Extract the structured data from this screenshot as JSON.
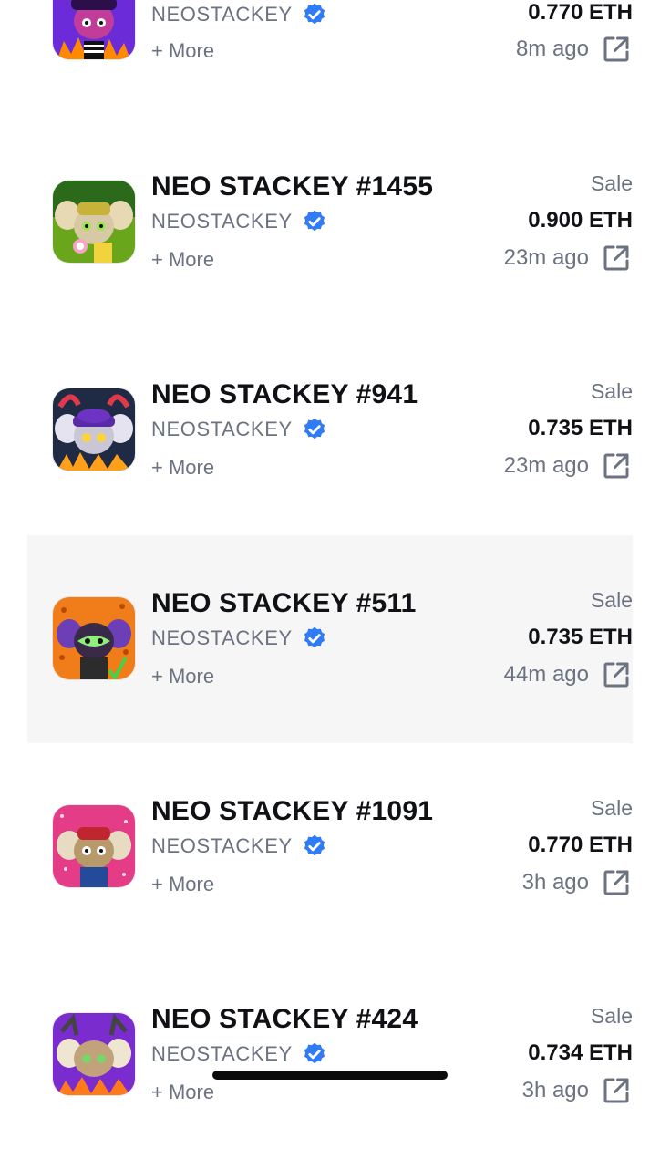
{
  "colors": {
    "verified_blue": "#2f7cf6",
    "text_primary": "#0f1115",
    "text_secondary": "#6b7280",
    "highlight_bg": "#f6f6f7"
  },
  "icons": {
    "verified": "verified-badge-icon",
    "external": "external-link-icon"
  },
  "items": [
    {
      "title": "",
      "collection": "NEOSTACKEY",
      "more": "+ More",
      "kind": "",
      "price": "0.770 ETH",
      "time": "8m ago",
      "thumb_bg": "#6c2bd9"
    },
    {
      "title": "NEO STACKEY #1455",
      "collection": "NEOSTACKEY",
      "more": "+ More",
      "kind": "Sale",
      "price": "0.900 ETH",
      "time": "23m ago",
      "thumb_bg": "#6aa61c"
    },
    {
      "title": "NEO STACKEY #941",
      "collection": "NEOSTACKEY",
      "more": "+ More",
      "kind": "Sale",
      "price": "0.735 ETH",
      "time": "23m ago",
      "thumb_bg": "#1f2a44"
    },
    {
      "title": "NEO STACKEY #511",
      "collection": "NEOSTACKEY",
      "more": "+ More",
      "kind": "Sale",
      "price": "0.735 ETH",
      "time": "44m ago",
      "thumb_bg": "#f07c1a"
    },
    {
      "title": "NEO STACKEY #1091",
      "collection": "NEOSTACKEY",
      "more": "+ More",
      "kind": "Sale",
      "price": "0.770 ETH",
      "time": "3h ago",
      "thumb_bg": "#e43c86"
    },
    {
      "title": "NEO STACKEY #424",
      "collection": "NEOSTACKEY",
      "more": "+ More",
      "kind": "Sale",
      "price": "0.734 ETH",
      "time": "3h ago",
      "thumb_bg": "#7a2ccf"
    }
  ]
}
